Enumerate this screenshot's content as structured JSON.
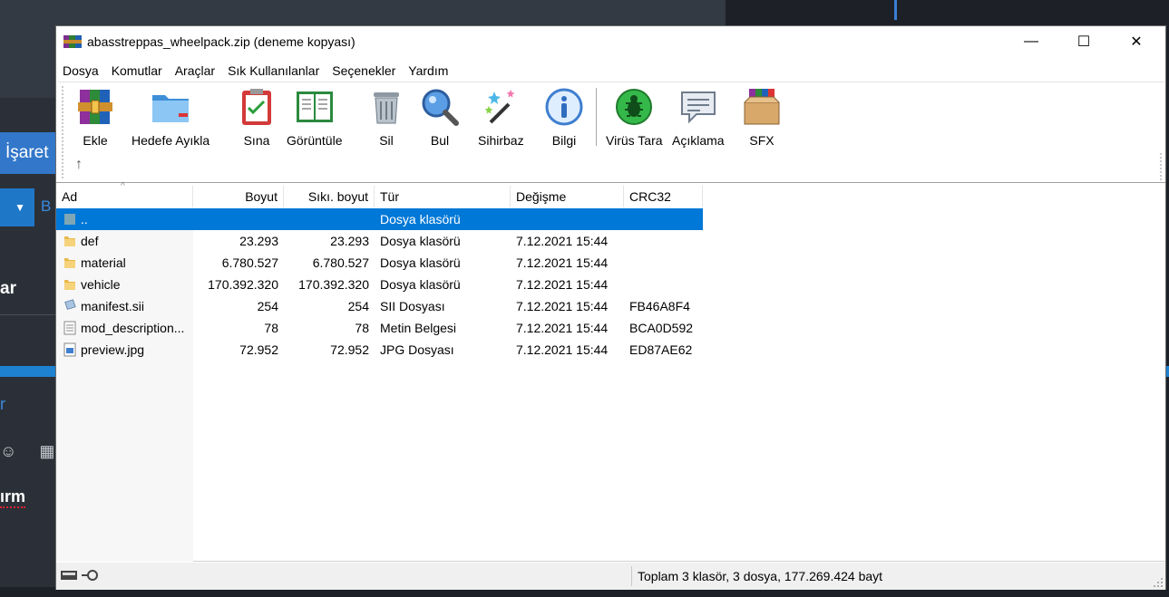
{
  "background": {
    "isaret_label": "İşaret",
    "b_label": "B",
    "ar_label": "ar",
    "r_label": "r",
    "icons_label": "☺ ▦",
    "irm_label": "ırm"
  },
  "window": {
    "title": "abasstreppas_wheelpack.zip (deneme kopyası)",
    "controls": {
      "minimize": "—",
      "maximize": "☐",
      "close": "✕"
    }
  },
  "menu": [
    "Dosya",
    "Komutlar",
    "Araçlar",
    "Sık Kullanılanlar",
    "Seçenekler",
    "Yardım"
  ],
  "toolbar": {
    "buttons": [
      {
        "label": "Ekle",
        "icon": "add-archive-icon"
      },
      {
        "label": "Hedefe Ayıkla",
        "icon": "extract-folder-icon"
      },
      {
        "label": "Sına",
        "icon": "test-clipboard-icon"
      },
      {
        "label": "Görüntüle",
        "icon": "view-book-icon"
      },
      {
        "label": "Sil",
        "icon": "trash-icon"
      },
      {
        "label": "Bul",
        "icon": "magnifier-icon"
      },
      {
        "label": "Sihirbaz",
        "icon": "wizard-wand-icon"
      },
      {
        "label": "Bilgi",
        "icon": "info-icon"
      },
      {
        "label": "Virüs Tara",
        "icon": "virus-scan-icon"
      },
      {
        "label": "Açıklama",
        "icon": "comment-icon"
      },
      {
        "label": "SFX",
        "icon": "sfx-box-icon"
      }
    ],
    "up_arrow": "↑"
  },
  "columns": [
    "Ad",
    "Boyut",
    "Sıkı. boyut",
    "Tür",
    "Değişme",
    "CRC32"
  ],
  "sort_indicator": "^",
  "files": [
    {
      "name": "..",
      "size": "",
      "packed": "",
      "type": "Dosya klasörü",
      "modified": "",
      "crc": "",
      "kind": "parent",
      "selected": true
    },
    {
      "name": "def",
      "size": "23.293",
      "packed": "23.293",
      "type": "Dosya klasörü",
      "modified": "7.12.2021 15:44",
      "crc": "",
      "kind": "folder",
      "selected": false
    },
    {
      "name": "material",
      "size": "6.780.527",
      "packed": "6.780.527",
      "type": "Dosya klasörü",
      "modified": "7.12.2021 15:44",
      "crc": "",
      "kind": "folder",
      "selected": false
    },
    {
      "name": "vehicle",
      "size": "170.392.320",
      "packed": "170.392.320",
      "type": "Dosya klasörü",
      "modified": "7.12.2021 15:44",
      "crc": "",
      "kind": "folder",
      "selected": false
    },
    {
      "name": "manifest.sii",
      "size": "254",
      "packed": "254",
      "type": "SII Dosyası",
      "modified": "7.12.2021 15:44",
      "crc": "FB46A8F4",
      "kind": "sii",
      "selected": false
    },
    {
      "name": "mod_description...",
      "size": "78",
      "packed": "78",
      "type": "Metin Belgesi",
      "modified": "7.12.2021 15:44",
      "crc": "BCA0D592",
      "kind": "text",
      "selected": false
    },
    {
      "name": "preview.jpg",
      "size": "72.952",
      "packed": "72.952",
      "type": "JPG Dosyası",
      "modified": "7.12.2021 15:44",
      "crc": "ED87AE62",
      "kind": "image",
      "selected": false
    }
  ],
  "status": {
    "summary": "Toplam 3 klasör, 3 dosya, 177.269.424 bayt"
  },
  "colors": {
    "selection": "#0078d7",
    "bg_app": "#2b3038",
    "bg_accent": "#1e82d0"
  }
}
